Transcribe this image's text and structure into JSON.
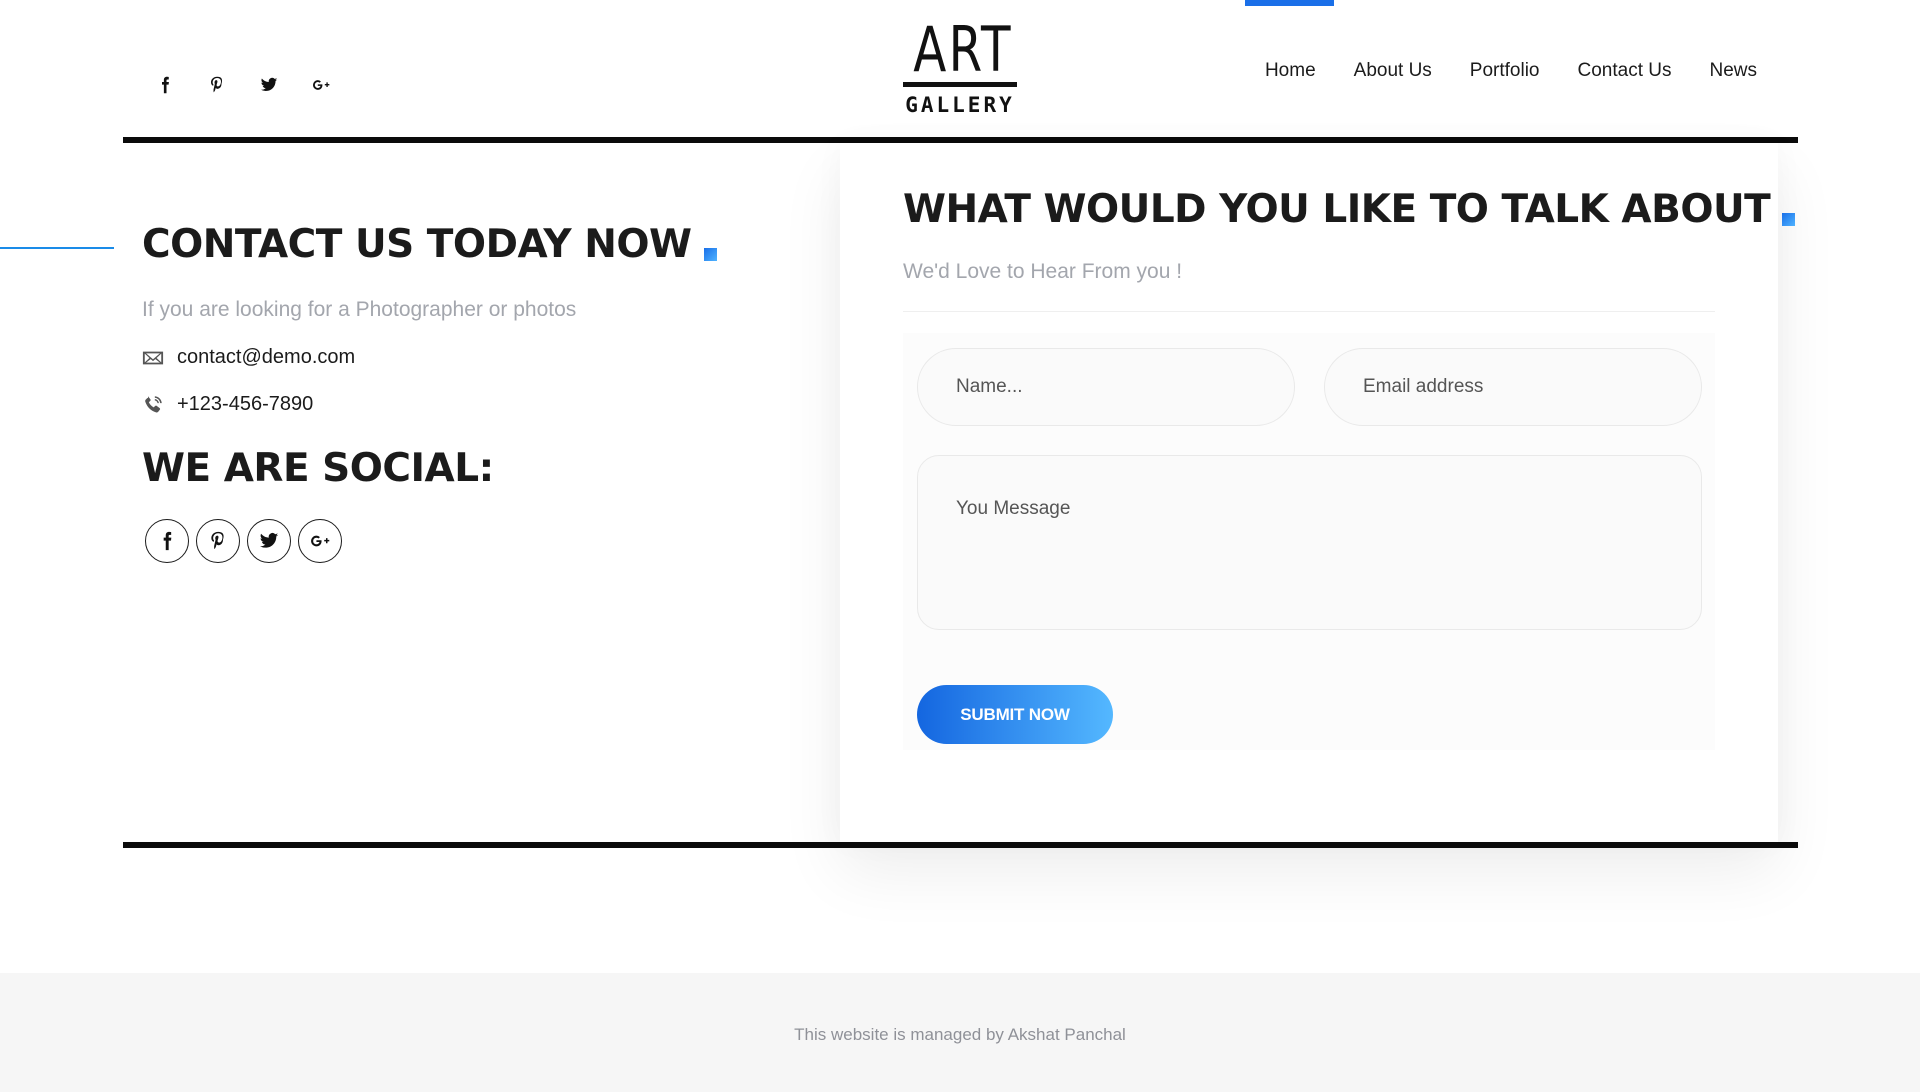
{
  "header": {
    "top_social": [
      {
        "icon": "facebook-icon"
      },
      {
        "icon": "pinterest-icon"
      },
      {
        "icon": "twitter-icon"
      },
      {
        "icon": "google-plus-icon"
      }
    ],
    "logo": {
      "line1": "ART",
      "line2": "GALLERY"
    },
    "nav": [
      {
        "label": "Home",
        "active": true
      },
      {
        "label": "About Us"
      },
      {
        "label": "Portfolio"
      },
      {
        "label": "Contact Us"
      },
      {
        "label": "News"
      }
    ],
    "accent_color": "#1a6fe8"
  },
  "contact": {
    "title": "CONTACT US TODAY NOW",
    "subtitle": "If you are looking for a Photographer or photos",
    "email": "contact@demo.com",
    "phone": "+123-456-7890",
    "social_title": "WE ARE SOCIAL:",
    "social_icons": [
      "facebook-icon",
      "pinterest-icon",
      "twitter-icon",
      "google-plus-icon"
    ]
  },
  "form": {
    "title": "WHAT WOULD YOU LIKE TO TALK ABOUT",
    "subtitle": "We'd Love to Hear From you !",
    "name_placeholder": "Name...",
    "email_placeholder": "Email address",
    "message_placeholder": "You Message",
    "submit_label": "SUBMIT NOW"
  },
  "footer": {
    "text": "This website is managed by Akshat Panchal"
  }
}
